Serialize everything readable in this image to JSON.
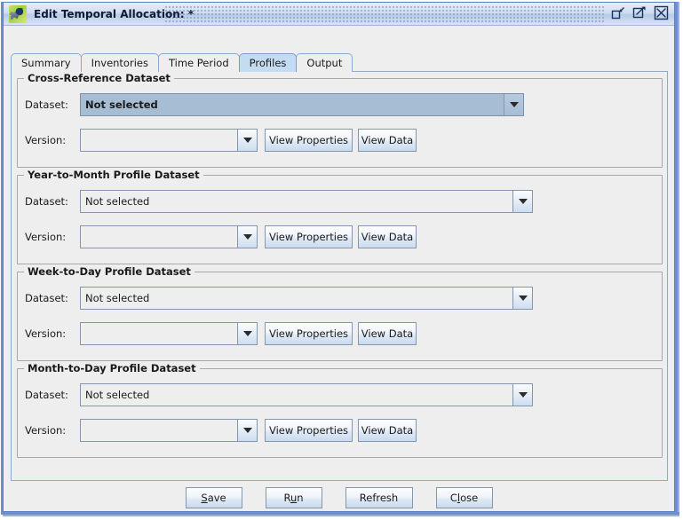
{
  "window": {
    "title": "Edit Temporal Allocation: *",
    "icon": "app-icon",
    "controls": [
      {
        "name": "restore-button",
        "label": "Restore"
      },
      {
        "name": "maximize-button",
        "label": "Maximize"
      },
      {
        "name": "close-button",
        "label": "Close"
      }
    ]
  },
  "tabs": [
    {
      "label": "Summary",
      "selected": false
    },
    {
      "label": "Inventories",
      "selected": false
    },
    {
      "label": "Time Period",
      "selected": false
    },
    {
      "label": "Profiles",
      "selected": true
    },
    {
      "label": "Output",
      "selected": false
    }
  ],
  "groups": [
    {
      "title": "Cross-Reference Dataset",
      "dataset_label": "Dataset:",
      "dataset_value": "Not selected",
      "dataset_focused": true,
      "version_label": "Version:",
      "version_value": "",
      "view_properties_label": "View Properties",
      "view_data_label": "View Data"
    },
    {
      "title": "Year-to-Month Profile Dataset",
      "dataset_label": "Dataset:",
      "dataset_value": "Not selected",
      "dataset_focused": false,
      "version_label": "Version:",
      "version_value": "",
      "view_properties_label": "View Properties",
      "view_data_label": "View Data"
    },
    {
      "title": "Week-to-Day Profile Dataset",
      "dataset_label": "Dataset:",
      "dataset_value": "Not selected",
      "dataset_focused": false,
      "version_label": "Version:",
      "version_value": "",
      "view_properties_label": "View Properties",
      "view_data_label": "View Data"
    },
    {
      "title": "Month-to-Day Profile Dataset",
      "dataset_label": "Dataset:",
      "dataset_value": "Not selected",
      "dataset_focused": false,
      "version_label": "Version:",
      "version_value": "",
      "view_properties_label": "View Properties",
      "view_data_label": "View Data"
    }
  ],
  "footer": {
    "buttons": [
      {
        "name": "save-button",
        "pre": "",
        "mnemonic": "S",
        "post": "ave"
      },
      {
        "name": "run-button",
        "pre": "R",
        "mnemonic": "u",
        "post": "n"
      },
      {
        "name": "refresh-button",
        "pre": "Refresh",
        "mnemonic": "",
        "post": ""
      },
      {
        "name": "close-button",
        "pre": "C",
        "mnemonic": "l",
        "post": "ose"
      }
    ]
  },
  "colors": {
    "frame": "#5b7fc0",
    "panel": "#eeeeee",
    "tab_selected": "#c4dcf2",
    "combo_focused": "#a6bdd4",
    "group_border": "#a8a8a8"
  }
}
